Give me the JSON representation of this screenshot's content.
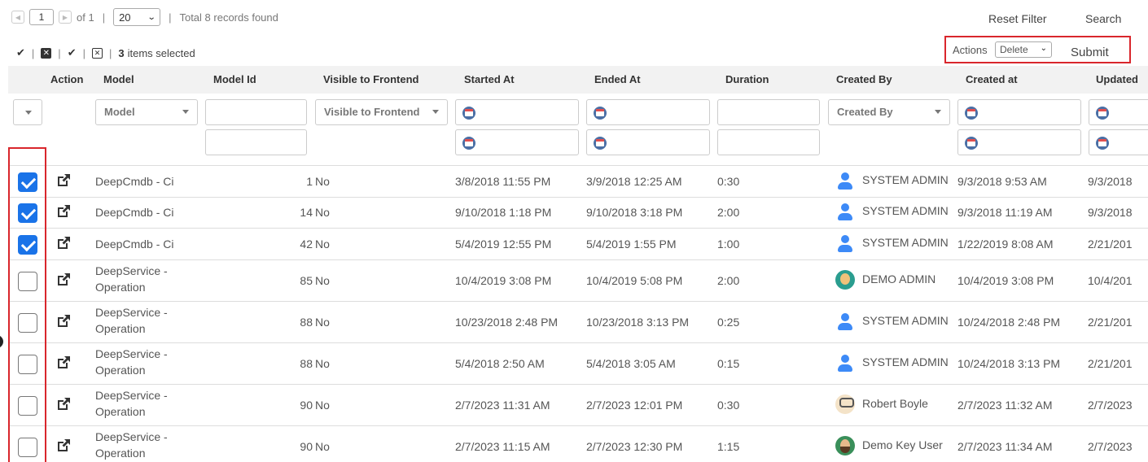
{
  "pager": {
    "page": "1",
    "of_label": "of 1",
    "page_size": "20",
    "total": "Total 8 records found"
  },
  "top_links": {
    "reset_filter": "Reset Filter",
    "search": "Search"
  },
  "selection": {
    "count": "3",
    "label": "items selected"
  },
  "actions": {
    "label": "Actions",
    "selected": "Delete",
    "submit": "Submit"
  },
  "columns": {
    "action": "Action",
    "model": "Model",
    "model_id": "Model Id",
    "visible": "Visible to Frontend",
    "started": "Started At",
    "ended": "Ended At",
    "duration": "Duration",
    "created_by": "Created By",
    "created_at": "Created at",
    "updated": "Updated"
  },
  "filters": {
    "model_placeholder": "Model",
    "visible_placeholder": "Visible to Frontend",
    "created_by_placeholder": "Created By"
  },
  "rows": [
    {
      "checked": true,
      "model": "DeepCmdb - Ci",
      "model_id": "1",
      "visible": "No",
      "started": "3/8/2018 11:55 PM",
      "ended": "3/9/2018 12:25 AM",
      "duration": "0:30",
      "avatar": "user-icon",
      "created_by": "SYSTEM ADMIN",
      "created_at": "9/3/2018 9:53 AM",
      "updated": "9/3/2018"
    },
    {
      "checked": true,
      "model": "DeepCmdb - Ci",
      "model_id": "14",
      "visible": "No",
      "started": "9/10/2018 1:18 PM",
      "ended": "9/10/2018 3:18 PM",
      "duration": "2:00",
      "avatar": "user-icon",
      "created_by": "SYSTEM ADMIN",
      "created_at": "9/3/2018 11:19 AM",
      "updated": "9/3/2018"
    },
    {
      "checked": true,
      "model": "DeepCmdb - Ci",
      "model_id": "42",
      "visible": "No",
      "started": "5/4/2019 12:55 PM",
      "ended": "5/4/2019 1:55 PM",
      "duration": "1:00",
      "avatar": "user-icon",
      "created_by": "SYSTEM ADMIN",
      "created_at": "1/22/2019 8:08 AM",
      "updated": "2/21/201"
    },
    {
      "checked": false,
      "model": "DeepService - Operation",
      "model_id": "85",
      "visible": "No",
      "started": "10/4/2019 3:08 PM",
      "ended": "10/4/2019 5:08 PM",
      "duration": "2:00",
      "avatar": "demo-admin-avatar",
      "created_by": "DEMO ADMIN",
      "created_at": "10/4/2019 3:08 PM",
      "updated": "10/4/201"
    },
    {
      "checked": false,
      "model": "DeepService - Operation",
      "model_id": "88",
      "visible": "No",
      "started": "10/23/2018 2:48 PM",
      "ended": "10/23/2018 3:13 PM",
      "duration": "0:25",
      "avatar": "user-icon",
      "created_by": "SYSTEM ADMIN",
      "created_at": "10/24/2018 2:48 PM",
      "updated": "2/21/201"
    },
    {
      "checked": false,
      "model": "DeepService - Operation",
      "model_id": "88",
      "visible": "No",
      "started": "5/4/2018 2:50 AM",
      "ended": "5/4/2018 3:05 AM",
      "duration": "0:15",
      "avatar": "user-icon",
      "created_by": "SYSTEM ADMIN",
      "created_at": "10/24/2018 3:13 PM",
      "updated": "2/21/201"
    },
    {
      "checked": false,
      "model": "DeepService - Operation",
      "model_id": "90",
      "visible": "No",
      "started": "2/7/2023 11:31 AM",
      "ended": "2/7/2023 12:01 PM",
      "duration": "0:30",
      "avatar": "robert-boyle-avatar",
      "created_by": "Robert Boyle",
      "created_at": "2/7/2023 11:32 AM",
      "updated": "2/7/2023"
    },
    {
      "checked": false,
      "model": "DeepService - Operation",
      "model_id": "90",
      "visible": "No",
      "started": "2/7/2023 11:15 AM",
      "ended": "2/7/2023 12:30 PM",
      "duration": "1:15",
      "avatar": "demo-key-user-avatar",
      "created_by": "Demo Key User",
      "created_at": "2/7/2023 11:34 AM",
      "updated": "2/7/2023"
    }
  ],
  "colors": {
    "highlight": "#d9262c",
    "checkbox": "#1a73e8",
    "avatar_user": "#3d8af7"
  }
}
